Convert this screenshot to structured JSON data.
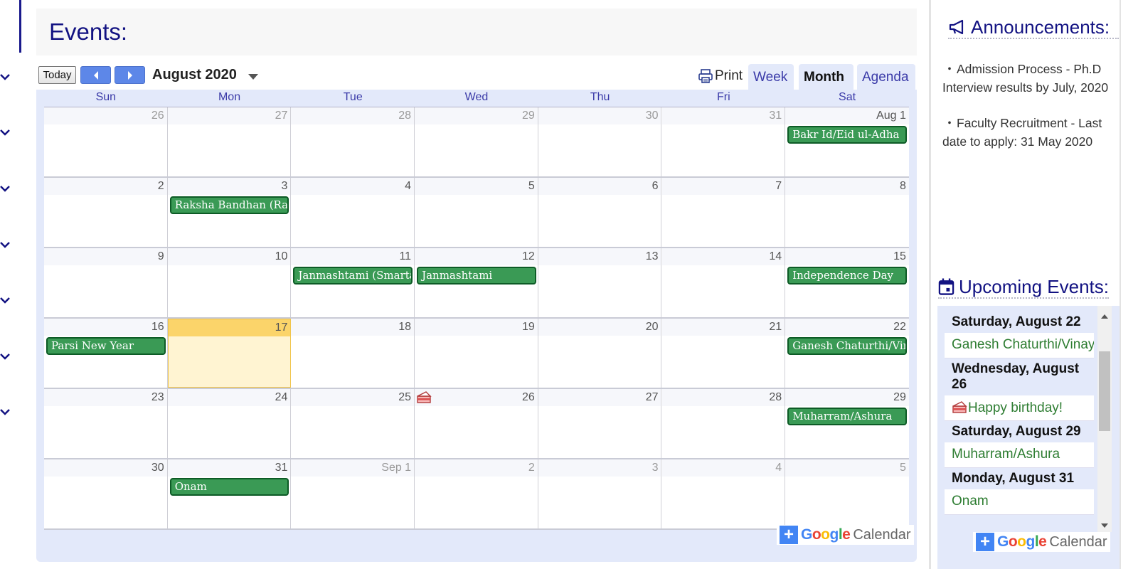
{
  "events_title": "Events:",
  "toolbar": {
    "today_label": "Today",
    "month_label": "August 2020",
    "print_label": "Print",
    "tabs": [
      {
        "label": "Week",
        "active": false
      },
      {
        "label": "Month",
        "active": true
      },
      {
        "label": "Agenda",
        "active": false
      }
    ]
  },
  "calendar": {
    "weekdays": [
      "Sun",
      "Mon",
      "Tue",
      "Wed",
      "Thu",
      "Fri",
      "Sat"
    ],
    "weeks": [
      [
        "26",
        "27",
        "28",
        "29",
        "30",
        "31",
        "Aug 1"
      ],
      [
        "2",
        "3",
        "4",
        "5",
        "6",
        "7",
        "8"
      ],
      [
        "9",
        "10",
        "11",
        "12",
        "13",
        "14",
        "15"
      ],
      [
        "16",
        "17",
        "18",
        "19",
        "20",
        "21",
        "22"
      ],
      [
        "23",
        "24",
        "25",
        "26",
        "27",
        "28",
        "29"
      ],
      [
        "30",
        "31",
        "Sep 1",
        "2",
        "3",
        "4",
        "5"
      ]
    ],
    "events": [
      {
        "label": "Bakr Id/Eid ul-Adha",
        "week": 0,
        "day": 6
      },
      {
        "label": "Raksha Bandhan (Rakhi)",
        "week": 1,
        "day": 1
      },
      {
        "label": "Janmashtami (Smarta)",
        "week": 2,
        "day": 2
      },
      {
        "label": "Janmashtami",
        "week": 2,
        "day": 3
      },
      {
        "label": "Independence Day",
        "week": 2,
        "day": 6
      },
      {
        "label": "Parsi New Year",
        "week": 3,
        "day": 0
      },
      {
        "label": "Ganesh Chaturthi/Vinayaka Chaturthi",
        "week": 3,
        "day": 6
      },
      {
        "label": "Muharram/Ashura",
        "week": 4,
        "day": 6
      },
      {
        "label": "Onam",
        "week": 5,
        "day": 1
      }
    ],
    "gcal_google": "Google",
    "gcal_calendar": "Calendar"
  },
  "sidebar": {
    "announcements_title": "Announcements:",
    "announcements": [
      "Admission Process - Ph.D Interview results by July, 2020",
      "Faculty Recruitment - Last date to apply: 31 May 2020"
    ],
    "upcoming_title": "Upcoming Events:",
    "upcoming": [
      {
        "date": "Saturday, August 22",
        "event": "Ganesh Chaturthi/Vinayaka Chaturthi",
        "birthday": false
      },
      {
        "date": "Wednesday, August 26",
        "event": "Happy birthday!",
        "birthday": true
      },
      {
        "date": "Saturday, August 29",
        "event": "Muharram/Ashura",
        "birthday": false
      },
      {
        "date": "Monday, August 31",
        "event": "Onam",
        "birthday": false
      }
    ]
  },
  "colors": {
    "accent": "#121282",
    "event_bg": "#3a9a55",
    "today_head": "#fbd46a",
    "calendar_bg": "#e3e9fa"
  }
}
